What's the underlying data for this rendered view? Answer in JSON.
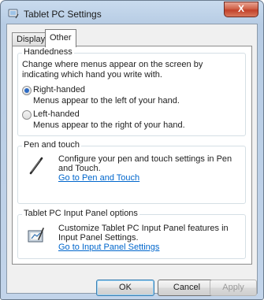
{
  "window": {
    "title": "Tablet PC Settings",
    "close_label": "X"
  },
  "tabs": [
    {
      "label": "Display",
      "selected": false
    },
    {
      "label": "Other",
      "selected": true
    }
  ],
  "handedness": {
    "legend": "Handedness",
    "description": "Change where menus appear on the screen by indicating which hand you write with.",
    "options": [
      {
        "label": "Right-handed",
        "sub": "Menus appear to the left of your hand.",
        "checked": true
      },
      {
        "label": "Left-handed",
        "sub": "Menus appear to the right of your hand.",
        "checked": false
      }
    ]
  },
  "pen_touch": {
    "legend": "Pen and touch",
    "icon": "pen-icon",
    "description": "Configure your pen and touch settings in Pen and Touch.",
    "link": "Go to Pen and Touch"
  },
  "input_panel": {
    "legend": "Tablet PC Input Panel options",
    "icon": "input-panel-icon",
    "description": "Customize Tablet PC Input Panel features in Input Panel Settings.",
    "link": "Go to Input Panel Settings"
  },
  "buttons": {
    "ok": "OK",
    "cancel": "Cancel",
    "apply": "Apply"
  },
  "colors": {
    "link": "#0066cc",
    "close_button": "#c2412a",
    "radio_dot": "#2d6bc4"
  }
}
